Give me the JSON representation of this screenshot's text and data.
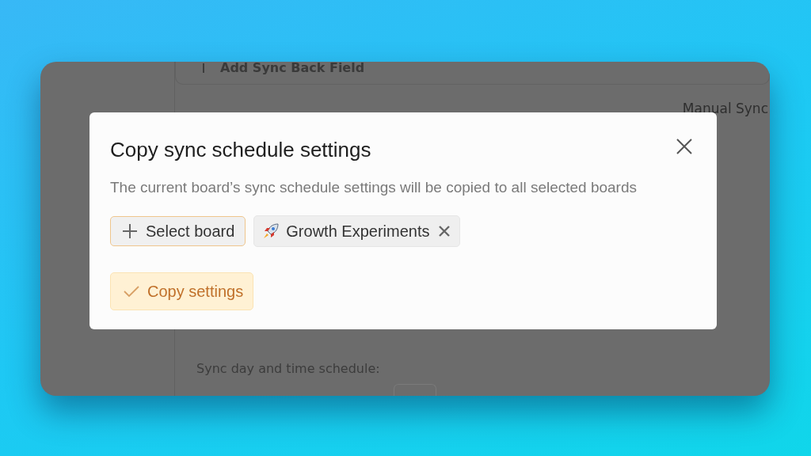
{
  "background": {
    "sync_back_field": "Add Sync Back Field",
    "manual_sync": "Manual Sync",
    "schedule_label": "Sync day and time schedule:"
  },
  "dialog": {
    "title": "Copy sync schedule settings",
    "description": "The current board’s sync schedule settings will be copied to all selected boards",
    "select_button": {
      "label": "Select board",
      "focused": true
    },
    "selected_boards": [
      {
        "name": "Growth Experiments"
      }
    ],
    "copy_button": "Copy settings"
  }
}
